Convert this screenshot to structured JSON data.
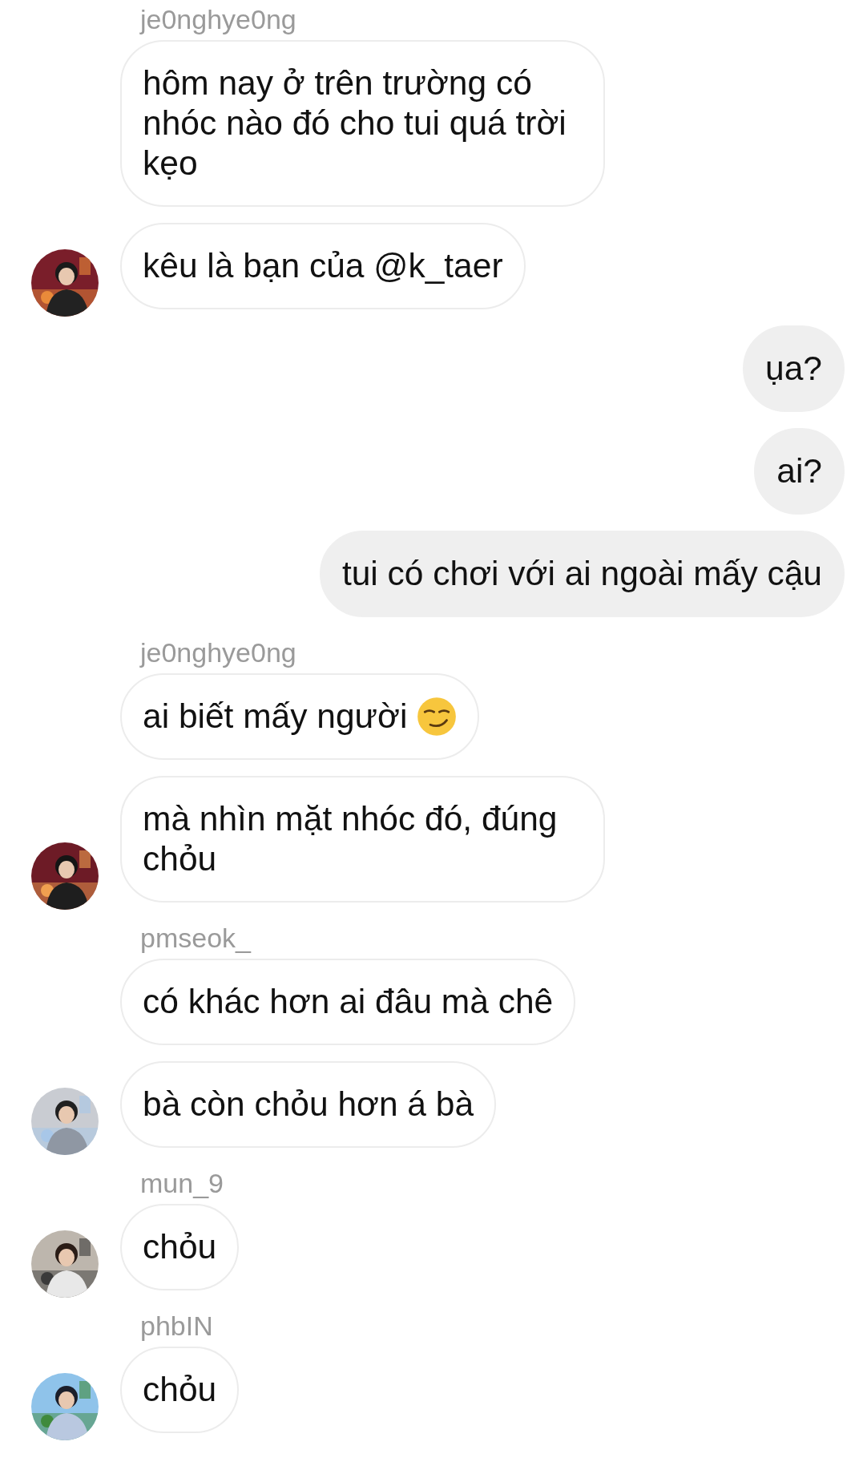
{
  "messages": [
    {
      "kind": "username",
      "text": "je0nghye0ng"
    },
    {
      "kind": "incoming",
      "text": "hôm nay ở trên trường có nhóc nào đó cho tui quá trời kẹo"
    },
    {
      "kind": "incoming",
      "text": "kêu là bạn của @k_taer"
    },
    {
      "kind": "outgoing",
      "text": "ụa?"
    },
    {
      "kind": "outgoing",
      "text": "ai?"
    },
    {
      "kind": "outgoing",
      "text": "tui có chơi với ai ngoài mấy cậu"
    },
    {
      "kind": "username",
      "text": "je0nghye0ng"
    },
    {
      "kind": "incoming",
      "text": "ai biết mấy người",
      "icon": {
        "kind": "smirk"
      }
    },
    {
      "kind": "incoming",
      "text": "mà nhìn mặt nhóc đó, đúng chỏu"
    },
    {
      "kind": "username",
      "text": "pmseok_"
    },
    {
      "kind": "incoming",
      "text": "có khác hơn ai đâu mà chê"
    },
    {
      "kind": "incoming",
      "text": "bà còn chỏu hơn á bà"
    },
    {
      "kind": "username",
      "text": "mun_9"
    },
    {
      "kind": "incoming",
      "text": "chỏu"
    },
    {
      "kind": "username",
      "text": "phbIN"
    },
    {
      "kind": "incoming",
      "text": "chỏu"
    }
  ]
}
